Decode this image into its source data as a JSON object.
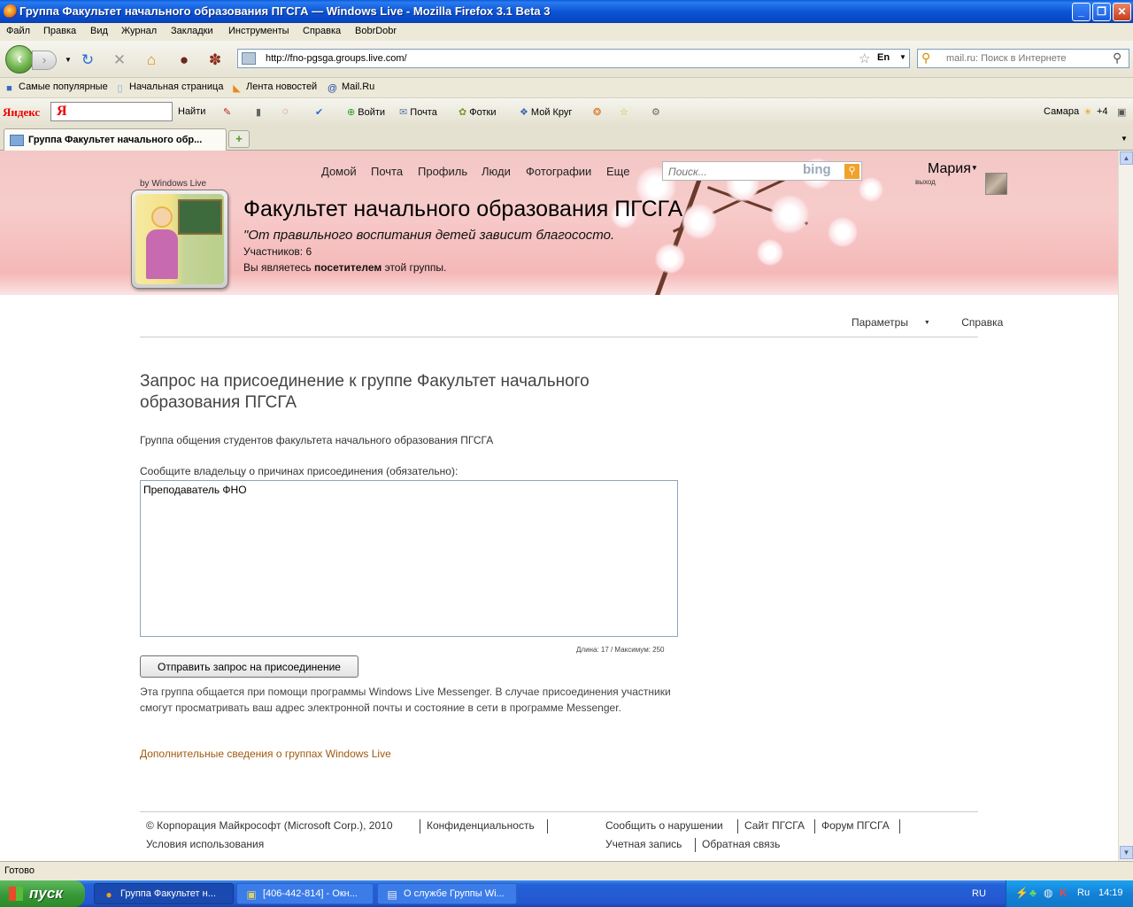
{
  "window": {
    "title": "Группа Факультет начального образования ПГСГА — Windows Live - Mozilla Firefox 3.1 Beta 3"
  },
  "menu": [
    "Файл",
    "Правка",
    "Вид",
    "Журнал",
    "Закладки",
    "Инструменты",
    "Справка",
    "BobrDobr"
  ],
  "address": {
    "url": "http://fno-pgsga.groups.live.com/",
    "lang": "En"
  },
  "websearch": {
    "placeholder": "mail.ru: Поиск в Интернете"
  },
  "bookmarks": [
    "Самые популярные",
    "Начальная страница",
    "Лента новостей",
    "Mail.Ru"
  ],
  "yandex": {
    "logo": "Яндекс",
    "find": "Найти",
    "login": "Войти",
    "mail": "Почта",
    "photos": "Фотки",
    "circle": "Мой Круг",
    "city": "Самара",
    "temp": "+4"
  },
  "tabs": [
    {
      "label": "Группа Факультет начального обр..."
    }
  ],
  "site": {
    "nav": [
      "Домой",
      "Почта",
      "Профиль",
      "Люди",
      "Фотографии",
      "Еще"
    ],
    "search_placeholder": "Поиск...",
    "search_brand": "bing",
    "user_name": "Мария",
    "logout": "выход",
    "by_windows_live": "by Windows Live"
  },
  "group": {
    "title": "Факультет начального образования ПГСГА",
    "motto": "\"От правильного воспитания детей зависит благососто.",
    "members": "Участников: 6",
    "visitor_prefix": "Вы являетесь ",
    "visitor_role": "посетителем",
    "visitor_suffix": " этой группы."
  },
  "sublinks": {
    "params": "Параметры",
    "help": "Справка"
  },
  "form": {
    "title": "Запрос на присоединение к группе Факультет начального образования ПГСГА",
    "description": "Группа общения студентов факультета начального образования ПГСГА",
    "reason_label": "Сообщите владельцу о причинах присоединения (обязательно):",
    "reason_value": "Преподаватель ФНО",
    "length_hint": "Длина: 17 / Максимум: 250",
    "submit": "Отправить запрос на присоединение",
    "notice": "Эта группа общается при помощи программы Windows Live Messenger. В случае присоединения участники смогут просматривать ваш адрес электронной почты и состояние в сети в программе Messenger.",
    "more_link": "Дополнительные сведения о группах Windows Live"
  },
  "footer": {
    "copyright": "© Корпорация Майкрософт (Microsoft Corp.), 2010",
    "privacy": "Конфиденциальность",
    "terms": "Условия использования",
    "report": "Сообщить о нарушении",
    "site": "Сайт ПГСГА",
    "forum": "Форум ПГСГА",
    "account": "Учетная запись",
    "feedback": "Обратная связь"
  },
  "status": "Готово",
  "taskbar": {
    "start": "пуск",
    "tasks": [
      "Группа Факультет н...",
      "[406-442-814] - Окн...",
      "О службе Группы Wi..."
    ],
    "lang": "RU",
    "tray_lang": "Ru",
    "clock": "14:19"
  }
}
